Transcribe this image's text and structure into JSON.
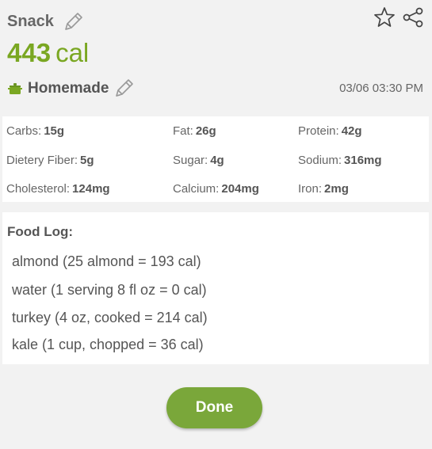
{
  "meal": {
    "name": "Snack",
    "calories": "443",
    "calories_unit": "cal",
    "source": "Homemade",
    "timestamp": "03/06 03:30 PM"
  },
  "icons": {
    "edit": "pencil-icon",
    "favorite": "star-icon",
    "share": "share-icon",
    "source": "cooking-pot-icon"
  },
  "colors": {
    "accent_green": "#7aa722",
    "button_green": "#7aa73a",
    "text_gray": "#555555",
    "background": "#f2f2f2"
  },
  "nutrients": [
    {
      "label": "Carbs:",
      "value": "15g"
    },
    {
      "label": "Fat:",
      "value": "26g"
    },
    {
      "label": "Protein:",
      "value": "42g"
    },
    {
      "label": "Dietery Fiber:",
      "value": "5g"
    },
    {
      "label": "Sugar:",
      "value": "4g"
    },
    {
      "label": "Sodium:",
      "value": "316mg"
    },
    {
      "label": "Cholesterol:",
      "value": "124mg"
    },
    {
      "label": "Calcium:",
      "value": "204mg"
    },
    {
      "label": "Iron:",
      "value": "2mg"
    }
  ],
  "food_log": {
    "title": "Food Log:",
    "items": [
      "almond (25 almond = 193 cal)",
      "water (1 serving 8 fl oz = 0 cal)",
      "turkey (4 oz, cooked = 214 cal)",
      "kale (1 cup, chopped = 36 cal)"
    ]
  },
  "actions": {
    "done_label": "Done"
  }
}
